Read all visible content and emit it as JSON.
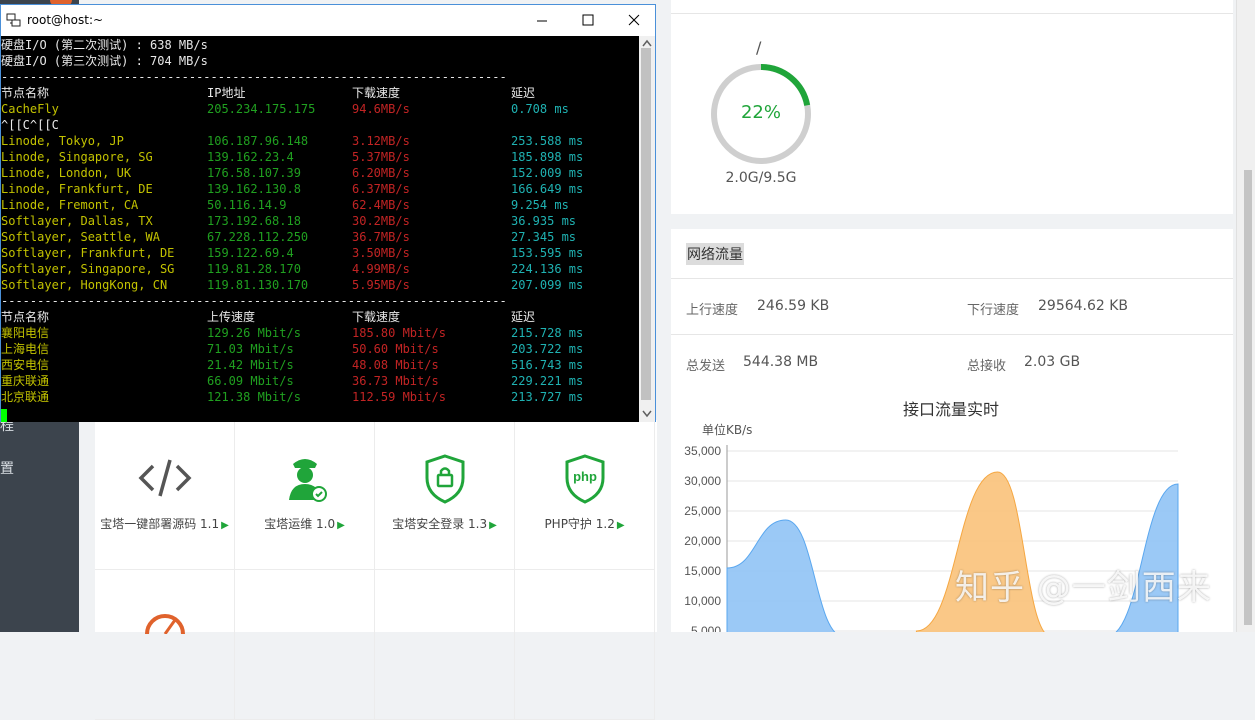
{
  "terminal": {
    "title": "root@host:~",
    "io_lines": [
      "硬盘I/O (第二次测试) : 638 MB/s",
      "硬盘I/O (第三次测试) : 704 MB/s"
    ],
    "separator": "----------------------------------------------------------------------",
    "table1": {
      "headers": [
        "节点名称",
        "IP地址",
        "下载速度",
        "延迟"
      ],
      "rows": [
        {
          "name": "CacheFly",
          "ip": "205.234.175.175",
          "speed": "94.6MB/s",
          "latency": "0.708 ms"
        },
        {
          "name": "Linode, Tokyo, JP",
          "ip": "106.187.96.148",
          "speed": "3.12MB/s",
          "latency": "253.588 ms"
        },
        {
          "name": "Linode, Singapore, SG",
          "ip": "139.162.23.4",
          "speed": "5.37MB/s",
          "latency": "185.898 ms"
        },
        {
          "name": "Linode, London, UK",
          "ip": "176.58.107.39",
          "speed": "6.20MB/s",
          "latency": "152.009 ms"
        },
        {
          "name": "Linode, Frankfurt, DE",
          "ip": "139.162.130.8",
          "speed": "6.37MB/s",
          "latency": "166.649 ms"
        },
        {
          "name": "Linode, Fremont, CA",
          "ip": "50.116.14.9",
          "speed": "62.4MB/s",
          "latency": "9.254 ms"
        },
        {
          "name": "Softlayer, Dallas, TX",
          "ip": "173.192.68.18",
          "speed": "30.2MB/s",
          "latency": "36.935 ms"
        },
        {
          "name": "Softlayer, Seattle, WA",
          "ip": "67.228.112.250",
          "speed": "36.7MB/s",
          "latency": "27.345 ms"
        },
        {
          "name": "Softlayer, Frankfurt, DE",
          "ip": "159.122.69.4",
          "speed": "3.50MB/s",
          "latency": "153.595 ms"
        },
        {
          "name": "Softlayer, Singapore, SG",
          "ip": "119.81.28.170",
          "speed": "4.99MB/s",
          "latency": "224.136 ms"
        },
        {
          "name": "Softlayer, HongKong, CN",
          "ip": "119.81.130.170",
          "speed": "5.95MB/s",
          "latency": "207.099 ms"
        }
      ],
      "stray": "^[[C^[[C"
    },
    "table2": {
      "headers": [
        "节点名称",
        "上传速度",
        "下载速度",
        "延迟"
      ],
      "rows": [
        {
          "name": "襄阳电信",
          "up": "129.26 Mbit/s",
          "down": "185.80 Mbit/s",
          "latency": "215.728 ms"
        },
        {
          "name": "上海电信",
          "up": "71.03 Mbit/s",
          "down": "50.60 Mbit/s",
          "latency": "203.722 ms"
        },
        {
          "name": "西安电信",
          "up": "21.42 Mbit/s",
          "down": "48.08 Mbit/s",
          "latency": "516.743 ms"
        },
        {
          "name": "重庆联通",
          "up": "66.09 Mbit/s",
          "down": "36.73 Mbit/s",
          "latency": "229.221 ms"
        },
        {
          "name": "北京联通",
          "up": "121.38 Mbit/s",
          "down": "112.59 Mbit/s",
          "latency": "213.727 ms"
        }
      ]
    }
  },
  "sidebar": {
    "items": [
      "程",
      "置"
    ]
  },
  "apps": [
    {
      "label": "宝塔一键部署源码 1.1",
      "icon": "code-icon"
    },
    {
      "label": "宝塔运维 1.0",
      "icon": "operator-icon"
    },
    {
      "label": "宝塔安全登录 1.3",
      "icon": "shield-lock-icon"
    },
    {
      "label": "PHP守护 1.2",
      "icon": "php-shield-icon"
    }
  ],
  "disk": {
    "path": "/",
    "percent": "22%",
    "percent_value": 22,
    "size": "2.0G/9.5G"
  },
  "network": {
    "title": "网络流量",
    "up_label": "上行速度",
    "up_value": "246.59 KB",
    "down_label": "下行速度",
    "down_value": "29564.62 KB",
    "sent_label": "总发送",
    "sent_value": "544.38 MB",
    "recv_label": "总接收",
    "recv_value": "2.03 GB"
  },
  "chart_data": {
    "type": "area",
    "title": "接口流量实时",
    "ylabel": "单位KB/s",
    "y_ticks": [
      "35,000",
      "30,000",
      "25,000",
      "20,000",
      "15,000",
      "10,000",
      "5,000"
    ],
    "ylim": [
      5000,
      35000
    ],
    "series": [
      {
        "color": "#90c3f5",
        "points": [
          [
            0,
            15500
          ],
          [
            0.13,
            23500
          ],
          [
            0.26,
            4000
          ]
        ]
      },
      {
        "color": "#f9c27a",
        "points": [
          [
            0.42,
            5000
          ],
          [
            0.6,
            31500
          ],
          [
            0.72,
            4000
          ]
        ]
      },
      {
        "color": "#90c3f5",
        "points": [
          [
            0.84,
            4000
          ],
          [
            1.0,
            29500
          ]
        ]
      }
    ]
  },
  "watermark": "知乎 @一剑西来",
  "colors": {
    "accent": "#20a53a",
    "terminal_bg": "#000000",
    "sidebar": "#3c444d"
  }
}
